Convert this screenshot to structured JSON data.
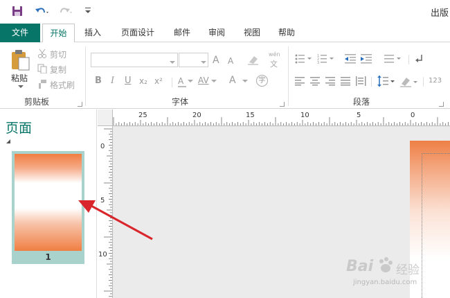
{
  "qat": {
    "title_fragment": "出版"
  },
  "tabs": [
    {
      "label": "文件"
    },
    {
      "label": "开始"
    },
    {
      "label": "插入"
    },
    {
      "label": "页面设计"
    },
    {
      "label": "邮件"
    },
    {
      "label": "审阅"
    },
    {
      "label": "视图"
    },
    {
      "label": "帮助"
    }
  ],
  "ribbon": {
    "clipboard": {
      "paste": "粘贴",
      "cut": "剪切",
      "copy": "复制",
      "format_painter": "格式刷",
      "group": "剪贴板"
    },
    "font": {
      "group": "字体",
      "bold": "B",
      "italic": "I",
      "underline": "U",
      "subscript": "x₂",
      "superscript": "x²",
      "spacing": "AV",
      "color_a": "A",
      "grow": "A",
      "shrink": "A",
      "phonetic": "wén",
      "phonetic2": "文",
      "enclose": "字"
    },
    "paragraph": {
      "group": "段落",
      "numbers": "123"
    }
  },
  "pages_pane": {
    "title": "页面",
    "page_number": "1"
  },
  "ruler": {
    "h_labels": [
      "25",
      "20",
      "15",
      "10",
      "5",
      "0"
    ],
    "v_labels": [
      "0",
      "5",
      "10"
    ]
  },
  "watermark": {
    "brand": "Bai",
    "brand2": "经验",
    "url": "jingyan.baidu.com"
  },
  "colors": {
    "accent": "#077568",
    "page_orange": "#f07f43",
    "arrow_red": "#d9262c",
    "thumb_frame": "#a9d2cd"
  }
}
